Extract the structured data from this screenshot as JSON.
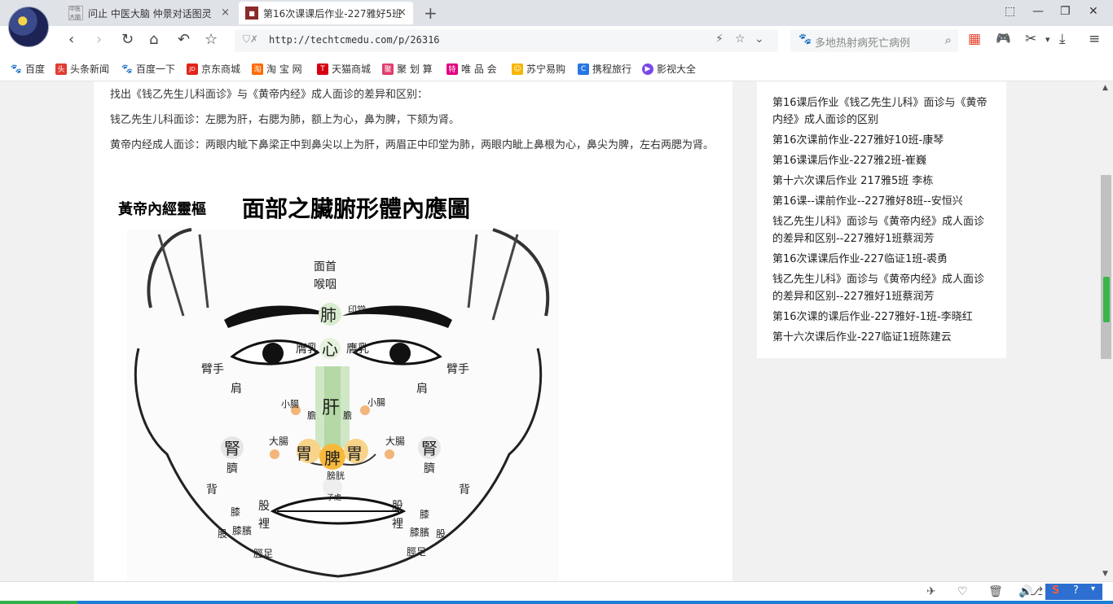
{
  "tabs": [
    {
      "favicon_text": "中医大脑",
      "title": "问止 中医大脑 仲景对话图灵",
      "close": "×"
    },
    {
      "favicon_text": "■",
      "title": "第16次课课后作业-227雅好5班",
      "close": "×"
    }
  ],
  "new_tab": "+",
  "window_controls": {
    "pin": "⬚",
    "minimize": "—",
    "restore": "❐",
    "close": "✕"
  },
  "nav": {
    "back": "‹",
    "forward": "›",
    "reload": "↻",
    "home": "⌂",
    "undo": "↶",
    "favorite": "☆"
  },
  "address": {
    "security": "⛉✗",
    "url": "http://techtcmedu.com/p/26316",
    "lightning": "⚡",
    "star": "☆",
    "dropdown": "⌄"
  },
  "search": {
    "placeholder": "多地热射病死亡病例",
    "icon": "🐾",
    "mag": "⌕"
  },
  "toolbar_right": {
    "apps": "▦",
    "game": "🎮",
    "scissors": "✂",
    "dropdown": "▾",
    "download": "⤓",
    "menu": "≡"
  },
  "bookmarks": [
    {
      "label": "百度",
      "icon": "🐾",
      "color": "#2a6ee6"
    },
    {
      "label": "头条新闻",
      "icon": "头",
      "color": "#e03c31"
    },
    {
      "label": "百度一下",
      "icon": "🐾",
      "color": "#2a6ee6"
    },
    {
      "label": "京东商城",
      "icon": "JD",
      "color": "#e1251b"
    },
    {
      "label": "淘 宝 网",
      "icon": "淘",
      "color": "#ff6a00"
    },
    {
      "label": "天猫商城",
      "icon": "T",
      "color": "#d60015"
    },
    {
      "label": "聚 划 算",
      "icon": "聚",
      "color": "#e03c6c"
    },
    {
      "label": "唯 品 会",
      "icon": "特",
      "color": "#e4007f"
    },
    {
      "label": "苏宁易购",
      "icon": "☺",
      "color": "#f7b500"
    },
    {
      "label": "携程旅行",
      "icon": "C",
      "color": "#2577e3"
    },
    {
      "label": "影视大全",
      "icon": "▶",
      "color": "#7b48e8"
    }
  ],
  "article": {
    "p1": "找出《钱乙先生儿科面诊》与《黄帝内经》成人面诊的差异和区别：",
    "p2": "钱乙先生儿科面诊：左腮为肝，右腮为肺，额上为心，鼻为脾，下颏为肾。",
    "p3": "黄帝内经成人面诊：两眼内眦下鼻梁正中到鼻尖以上为肝，两眉正中印堂为肺，两眼内眦上鼻根为心，鼻尖为脾，左右两腮为肾。",
    "figure": {
      "left_title": "黃帝內經靈樞",
      "main_title": "面部之臟腑形體內應圖",
      "labels": {
        "mianshou": "面首",
        "houyan": "喉咽",
        "fei": "肺",
        "yintang": "印堂",
        "xin": "心",
        "ying_l": "膺乳",
        "ying_r": "膺乳",
        "gan": "肝",
        "dan_l": "膽",
        "dan_r": "膽",
        "xiaochang_l": "小腸",
        "xiaochang_r": "小腸",
        "bishou_l": "臂手",
        "jian_l": "肩",
        "bishou_r": "臂手",
        "jian_r": "肩",
        "shen_l": "腎",
        "qi_l": "臍",
        "shen_r": "腎",
        "qi_r": "臍",
        "dachang_l": "大腸",
        "dachang_r": "大腸",
        "wei_l": "胃",
        "pi": "脾",
        "wei_r": "胃",
        "pangguang": "膀胱",
        "zichu": "子處",
        "bei_l": "背",
        "bei_r": "背",
        "gu_l": "股",
        "li_l": "裡",
        "gu_r": "股",
        "li_r": "裡",
        "xi_l": "膝",
        "bin_l": "膝臏",
        "gu2_l": "股",
        "xi_r": "膝",
        "bin_r": "膝臏",
        "gu2_r": "股",
        "jing_l": "脛足",
        "jing_r": "脛足"
      }
    }
  },
  "sidebar_links": [
    "第16课后作业《钱乙先生儿科》面诊与《黄帝内经》成人面诊的区别",
    "第16次课前作业-227雅好10班-康琴",
    "第16课课后作业-227雅2班-崔巍",
    "第十六次课后作业 217雅5班 李栋",
    "第16课--课前作业--227雅好8班--安恒兴",
    "钱乙先生儿科》面诊与《黄帝内经》成人面诊的差异和区别--227雅好1班蔡润芳",
    "第16次课课后作业-227临证1班-裘勇",
    "钱乙先生儿科》面诊与《黄帝内经》成人面诊的差异和区别--227雅好1班蔡润芳",
    "第16次课的课后作业-227雅好-1班-李晓红",
    "第十六次课后作业-227临证1班陈建云"
  ],
  "statusbar": {
    "icons": [
      "✈",
      "♡",
      "🗑",
      "🔊",
      "⎇"
    ],
    "ime": [
      "S",
      "?",
      "▾"
    ]
  },
  "scrollbar": {
    "up": "▲",
    "down": "▼"
  }
}
